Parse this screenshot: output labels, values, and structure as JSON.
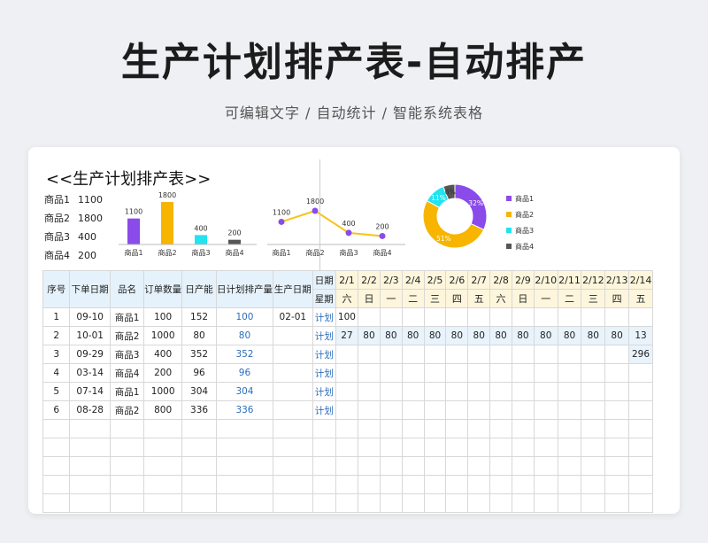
{
  "page": {
    "title": "生产计划排产表-自动排产",
    "subtitle": "可编辑文字 / 自动统计 / 智能系统表格"
  },
  "sheet": {
    "title": "<<生产计划排产表>>",
    "summary": [
      {
        "name": "商品1",
        "value": "1100"
      },
      {
        "name": "商品2",
        "value": "1800"
      },
      {
        "name": "商品3",
        "value": "400"
      },
      {
        "name": "商品4",
        "value": "200"
      }
    ]
  },
  "chart_data": [
    {
      "type": "bar",
      "categories": [
        "商品1",
        "商品2",
        "商品3",
        "商品4"
      ],
      "values": [
        1100,
        1800,
        400,
        200
      ],
      "colors": [
        "#8a4bea",
        "#f7b500",
        "#22e3f0",
        "#555555"
      ]
    },
    {
      "type": "line",
      "categories": [
        "商品1",
        "商品2",
        "商品3",
        "商品4"
      ],
      "values": [
        1100,
        1800,
        400,
        200
      ],
      "line_color": "#f5c518",
      "marker_color": "#8a4bea"
    },
    {
      "type": "pie",
      "categories": [
        "商品1",
        "商品2",
        "商品3",
        "商品4"
      ],
      "values": [
        32,
        51,
        11,
        6
      ],
      "labels": [
        "32%",
        "51%",
        "11%",
        "6%"
      ],
      "colors": [
        "#8a4bea",
        "#f7b500",
        "#22e3f0",
        "#555555"
      ],
      "legend": "right"
    }
  ],
  "table": {
    "headers": {
      "seq": "序号",
      "order_date": "下单日期",
      "product": "品名",
      "order_qty": "订单数量",
      "daily_cap": "日产能",
      "daily_plan": "日计划排产量",
      "prod_date": "生产日期",
      "date_label": "日期",
      "week_label": "星期"
    },
    "dates": [
      "2/1",
      "2/2",
      "2/3",
      "2/4",
      "2/5",
      "2/6",
      "2/7",
      "2/8",
      "2/9",
      "2/10",
      "2/11",
      "2/12",
      "2/13",
      "2/14"
    ],
    "weekdays": [
      "六",
      "日",
      "一",
      "二",
      "三",
      "四",
      "五",
      "六",
      "日",
      "一",
      "二",
      "三",
      "四",
      "五"
    ],
    "rows": [
      {
        "seq": "1",
        "order_date": "09-10",
        "product": "商品1",
        "qty": "100",
        "cap": "152",
        "plan": "100",
        "prod_date": "02-01",
        "type": "计划",
        "cells": [
          "100",
          "",
          "",
          "",
          "",
          "",
          "",
          "",
          "",
          "",
          "",
          "",
          "",
          ""
        ]
      },
      {
        "seq": "2",
        "order_date": "10-01",
        "product": "商品2",
        "qty": "1000",
        "cap": "80",
        "plan": "80",
        "prod_date": "",
        "type": "计划",
        "cells": [
          "27",
          "80",
          "80",
          "80",
          "80",
          "80",
          "80",
          "80",
          "80",
          "80",
          "80",
          "80",
          "80",
          "13"
        ]
      },
      {
        "seq": "3",
        "order_date": "09-29",
        "product": "商品3",
        "qty": "400",
        "cap": "352",
        "plan": "352",
        "prod_date": "",
        "type": "计划",
        "cells": [
          "",
          "",
          "",
          "",
          "",
          "",
          "",
          "",
          "",
          "",
          "",
          "",
          "",
          "296"
        ]
      },
      {
        "seq": "4",
        "order_date": "03-14",
        "product": "商品4",
        "qty": "200",
        "cap": "96",
        "plan": "96",
        "prod_date": "",
        "type": "计划",
        "cells": [
          "",
          "",
          "",
          "",
          "",
          "",
          "",
          "",
          "",
          "",
          "",
          "",
          "",
          ""
        ]
      },
      {
        "seq": "5",
        "order_date": "07-14",
        "product": "商品1",
        "qty": "1000",
        "cap": "304",
        "plan": "304",
        "prod_date": "",
        "type": "计划",
        "cells": [
          "",
          "",
          "",
          "",
          "",
          "",
          "",
          "",
          "",
          "",
          "",
          "",
          "",
          ""
        ]
      },
      {
        "seq": "6",
        "order_date": "08-28",
        "product": "商品2",
        "qty": "800",
        "cap": "336",
        "plan": "336",
        "prod_date": "",
        "type": "计划",
        "cells": [
          "",
          "",
          "",
          "",
          "",
          "",
          "",
          "",
          "",
          "",
          "",
          "",
          "",
          ""
        ]
      }
    ]
  }
}
